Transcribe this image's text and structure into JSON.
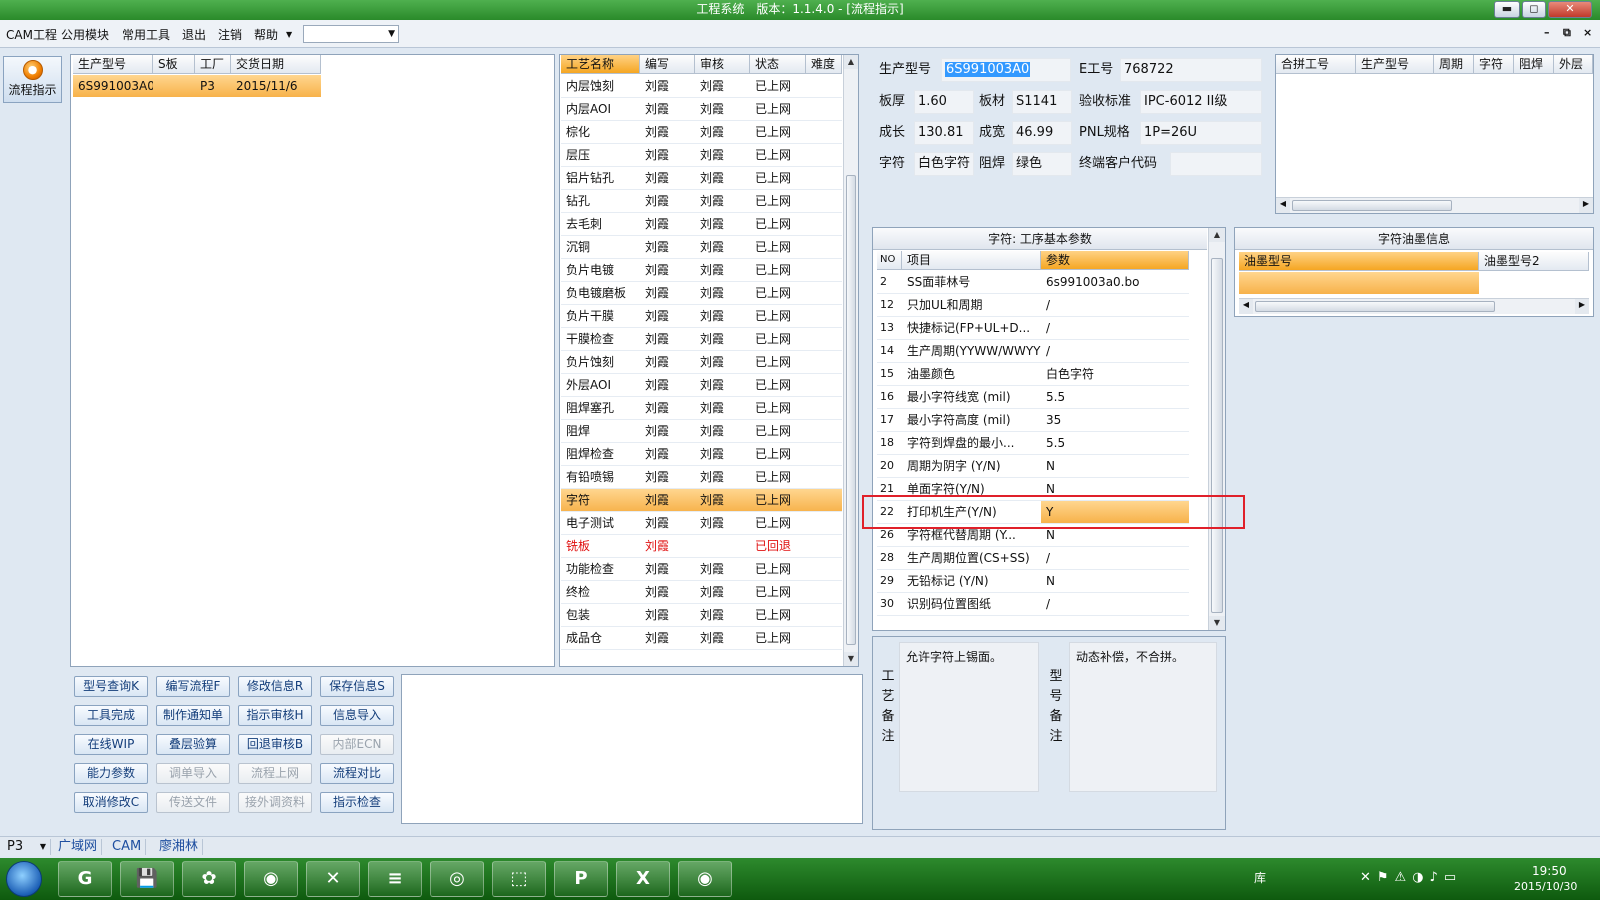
{
  "window": {
    "title": "工程系统　版本：1.1.4.0 - [流程指示]",
    "min_label": "▬",
    "max_label": "◻",
    "close_label": "✕"
  },
  "menu": {
    "items": [
      "CAM工程",
      "公用模块",
      "常用工具",
      "退出",
      "注销",
      "帮助"
    ],
    "combo_value": "",
    "mdi_buttons": [
      "–",
      "⧉",
      "×"
    ]
  },
  "left_button": {
    "label": "流程指示"
  },
  "order_table": {
    "headers": [
      "生产型号",
      "S板",
      "工厂",
      "交货日期"
    ],
    "rows": [
      {
        "model": "6S991003A0",
        "s": "",
        "factory": "P3",
        "date": "2015/11/6"
      }
    ]
  },
  "process_table": {
    "headers": [
      "工艺名称",
      "编写",
      "审核",
      "状态",
      "难度"
    ],
    "rows": [
      {
        "name": "内层蚀刻",
        "writer": "刘霞",
        "reviewer": "刘霞",
        "status": "已上网"
      },
      {
        "name": "内层AOI",
        "writer": "刘霞",
        "reviewer": "刘霞",
        "status": "已上网"
      },
      {
        "name": "棕化",
        "writer": "刘霞",
        "reviewer": "刘霞",
        "status": "已上网"
      },
      {
        "name": "层压",
        "writer": "刘霞",
        "reviewer": "刘霞",
        "status": "已上网"
      },
      {
        "name": "铝片钻孔",
        "writer": "刘霞",
        "reviewer": "刘霞",
        "status": "已上网"
      },
      {
        "name": "钻孔",
        "writer": "刘霞",
        "reviewer": "刘霞",
        "status": "已上网"
      },
      {
        "name": "去毛刺",
        "writer": "刘霞",
        "reviewer": "刘霞",
        "status": "已上网"
      },
      {
        "name": "沉铜",
        "writer": "刘霞",
        "reviewer": "刘霞",
        "status": "已上网"
      },
      {
        "name": "负片电镀",
        "writer": "刘霞",
        "reviewer": "刘霞",
        "status": "已上网"
      },
      {
        "name": "负电镀磨板",
        "writer": "刘霞",
        "reviewer": "刘霞",
        "status": "已上网"
      },
      {
        "name": "负片干膜",
        "writer": "刘霞",
        "reviewer": "刘霞",
        "status": "已上网"
      },
      {
        "name": "干膜检查",
        "writer": "刘霞",
        "reviewer": "刘霞",
        "status": "已上网"
      },
      {
        "name": "负片蚀刻",
        "writer": "刘霞",
        "reviewer": "刘霞",
        "status": "已上网"
      },
      {
        "name": "外层AOI",
        "writer": "刘霞",
        "reviewer": "刘霞",
        "status": "已上网"
      },
      {
        "name": "阻焊塞孔",
        "writer": "刘霞",
        "reviewer": "刘霞",
        "status": "已上网"
      },
      {
        "name": "阻焊",
        "writer": "刘霞",
        "reviewer": "刘霞",
        "status": "已上网"
      },
      {
        "name": "阻焊检查",
        "writer": "刘霞",
        "reviewer": "刘霞",
        "status": "已上网"
      },
      {
        "name": "有铅喷锡",
        "writer": "刘霞",
        "reviewer": "刘霞",
        "status": "已上网"
      },
      {
        "name": "字符",
        "writer": "刘霞",
        "reviewer": "刘霞",
        "status": "已上网",
        "selected": true
      },
      {
        "name": "电子测试",
        "writer": "刘霞",
        "reviewer": "刘霞",
        "status": "已上网"
      },
      {
        "name": "铣板",
        "writer": "刘霞",
        "reviewer": "",
        "status": "已回退",
        "red": true
      },
      {
        "name": "功能检查",
        "writer": "刘霞",
        "reviewer": "刘霞",
        "status": "已上网"
      },
      {
        "name": "终检",
        "writer": "刘霞",
        "reviewer": "刘霞",
        "status": "已上网"
      },
      {
        "name": "包装",
        "writer": "刘霞",
        "reviewer": "刘霞",
        "status": "已上网"
      },
      {
        "name": "成品仓",
        "writer": "刘霞",
        "reviewer": "刘霞",
        "status": "已上网"
      }
    ]
  },
  "buttons": [
    [
      "型号查询K",
      "编写流程F",
      "修改信息R",
      "保存信息S"
    ],
    [
      "工具完成",
      "制作通知单",
      "指示审核H",
      "信息导入"
    ],
    [
      "在线WIP",
      "叠层验算",
      "回退审核B",
      "内部ECN"
    ],
    [
      "能力参数",
      "调单导入",
      "流程上网",
      "流程对比"
    ],
    [
      "取消修改C",
      "传送文件",
      "接外调资料",
      "指示检查"
    ]
  ],
  "disabled_buttons": [
    "内部ECN",
    "调单导入",
    "流程上网",
    "传送文件",
    "接外调资料"
  ],
  "info": {
    "model_label": "生产型号",
    "model_value": "6S991003A0",
    "ework_label": "E工号",
    "ework_value": "768722",
    "thick_label": "板厚",
    "thick_value": "1.60",
    "material_label": "板材",
    "material_value": "S1141",
    "standard_label": "验收标准",
    "standard_value": "IPC-6012 II级",
    "length_label": "成长",
    "length_value": "130.81",
    "width_label": "成宽",
    "width_value": "46.99",
    "pnl_label": "PNL规格",
    "pnl_value": "1P=26U",
    "char_label": "字符",
    "char_value": "白色字符",
    "mask_label": "阻焊",
    "mask_value": "绿色",
    "customer_label": "终端客户代码",
    "customer_value": ""
  },
  "merge_table": {
    "headers": [
      "合拼工号",
      "生产型号",
      "周期",
      "字符",
      "阻焊",
      "外层"
    ]
  },
  "params": {
    "title": "字符: 工序基本参数",
    "headers": [
      "NO",
      "项目",
      "参数"
    ],
    "rows": [
      {
        "no": "2",
        "item": "SS面菲林号",
        "value": "6s991003a0.bo"
      },
      {
        "no": "12",
        "item": "只加UL和周期",
        "value": "/"
      },
      {
        "no": "13",
        "item": "快捷标记(FP+UL+D...",
        "value": "/"
      },
      {
        "no": "14",
        "item": "生产周期(YYWW/WWYY)",
        "value": "/"
      },
      {
        "no": "15",
        "item": "油墨颜色",
        "value": "白色字符"
      },
      {
        "no": "16",
        "item": "最小字符线宽 (mil)",
        "value": "5.5"
      },
      {
        "no": "17",
        "item": "最小字符高度 (mil)",
        "value": "35"
      },
      {
        "no": "18",
        "item": "字符到焊盘的最小...",
        "value": "5.5"
      },
      {
        "no": "20",
        "item": "周期为阴字 (Y/N)",
        "value": "N"
      },
      {
        "no": "21",
        "item": "单面字符(Y/N)",
        "value": "N"
      },
      {
        "no": "22",
        "item": "打印机生产(Y/N)",
        "value": "Y",
        "selected": true
      },
      {
        "no": "26",
        "item": "字符框代替周期 (Y...",
        "value": "N"
      },
      {
        "no": "28",
        "item": "生产周期位置(CS+SS)",
        "value": "/"
      },
      {
        "no": "29",
        "item": "无铅标记 (Y/N)",
        "value": "N"
      },
      {
        "no": "30",
        "item": "识别码位置图纸",
        "value": "/"
      }
    ]
  },
  "ink": {
    "title": "字符油墨信息",
    "headers": [
      "油墨型号",
      "油墨型号2"
    ]
  },
  "notes": {
    "process_label": "工艺备注",
    "process_text": "允许字符上锡面。",
    "model_label": "型号备注",
    "model_text": "动态补偿，不合拼。"
  },
  "status": {
    "combo": "P3",
    "items": [
      "广域网",
      "CAM",
      "廖湘林"
    ]
  },
  "taskbar": {
    "apps": [
      "G",
      "💾",
      "✿",
      "◉",
      "✕",
      "≡",
      "◎",
      "⬚",
      "P",
      "X",
      "◉"
    ],
    "tray_folder": "库",
    "time": "19:50",
    "date": "2015/10/30"
  }
}
